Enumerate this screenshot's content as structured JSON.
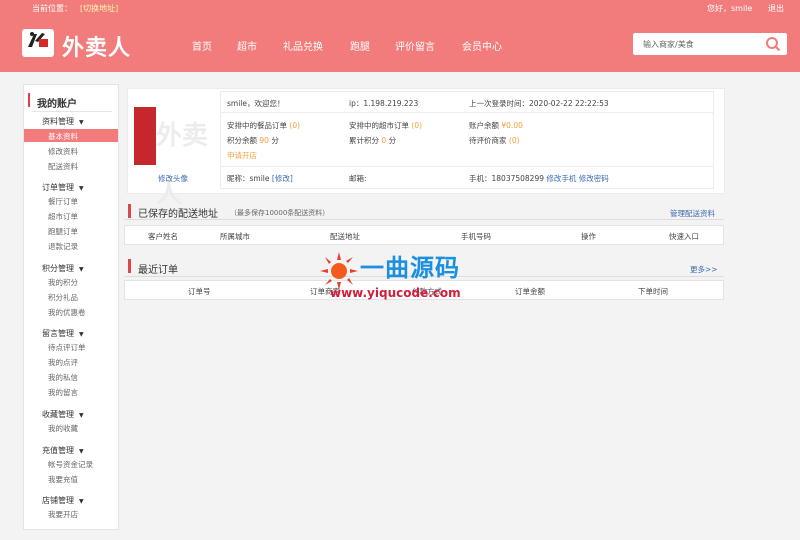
{
  "topbar": {
    "location_label": "当前位置：",
    "switch_label": "[切换地址]",
    "greeting": "您好，smile",
    "logout": "退出"
  },
  "brand": {
    "name": "外卖人"
  },
  "nav": [
    "首页",
    "超市",
    "礼品兑换",
    "跑腿",
    "评价留言",
    "会员中心"
  ],
  "search": {
    "placeholder": "输入商家/美食"
  },
  "sidebar": {
    "title": "我的账户",
    "groups": [
      {
        "label": "资料管理",
        "items": [
          "基本资料",
          "修改资料",
          "配送资料"
        ]
      },
      {
        "label": "订单管理",
        "items": [
          "餐厅订单",
          "超市订单",
          "跑腿订单",
          "退款记录"
        ]
      },
      {
        "label": "积分管理",
        "items": [
          "我的积分",
          "积分礼品",
          "我的优惠卷"
        ]
      },
      {
        "label": "留言管理",
        "items": [
          "待点评订单",
          "我的点评",
          "我的私信",
          "我的留言"
        ]
      },
      {
        "label": "收藏管理",
        "items": [
          "我的收藏"
        ]
      },
      {
        "label": "充值管理",
        "items": [
          "帐号资金记录",
          "我要充值"
        ]
      },
      {
        "label": "店铺管理",
        "items": [
          "我要开店"
        ]
      }
    ]
  },
  "profile": {
    "avatar_text": "外卖人",
    "edit_avatar": "修改头像",
    "welcome": "smile，欢迎您！",
    "ip_label": "ip：",
    "ip": "1.198.219.223",
    "last_login_label": "上一次登录时间：",
    "last_login": "2020-02-22 22:22:53",
    "food_orders_label": "安排中的餐品订单",
    "food_orders": "(0)",
    "market_orders_label": "安排中的超市订单",
    "market_orders": "(0)",
    "balance_label": "账户余额",
    "balance": "¥0.00",
    "points_label": "积分余额",
    "points": "90",
    "points_unit": "分",
    "total_points_label": "累计积分",
    "total_points": "0",
    "total_points_unit": "分",
    "to_rate_label": "待评价商家",
    "to_rate": "(0)",
    "apply_shop": "申请开店",
    "nickname_label": "昵称：smile",
    "nickname_edit": "[修改]",
    "email_label": "邮箱:",
    "phone_label": "手机：18037508299",
    "edit_phone": "修改手机",
    "edit_password": "修改密码"
  },
  "addresses": {
    "title": "已保存的配送地址",
    "note": "（最多保存10000条配送资料）",
    "manage": "管理配送资料",
    "columns": [
      "客户姓名",
      "所属城市",
      "配送地址",
      "手机号码",
      "操作",
      "快速入口"
    ]
  },
  "orders": {
    "title": "最近订单",
    "more": "更多>>",
    "columns": [
      "订单号",
      "订单商家",
      "付款方式",
      "订单金额",
      "下单时间"
    ]
  },
  "watermark": {
    "name": "一曲源码",
    "url": "www.yiqucode.com"
  },
  "colors": {
    "header": "#f27c7c",
    "accent": "#d84a4a",
    "link": "#3a68b3",
    "highlight": "#f1a13a"
  }
}
